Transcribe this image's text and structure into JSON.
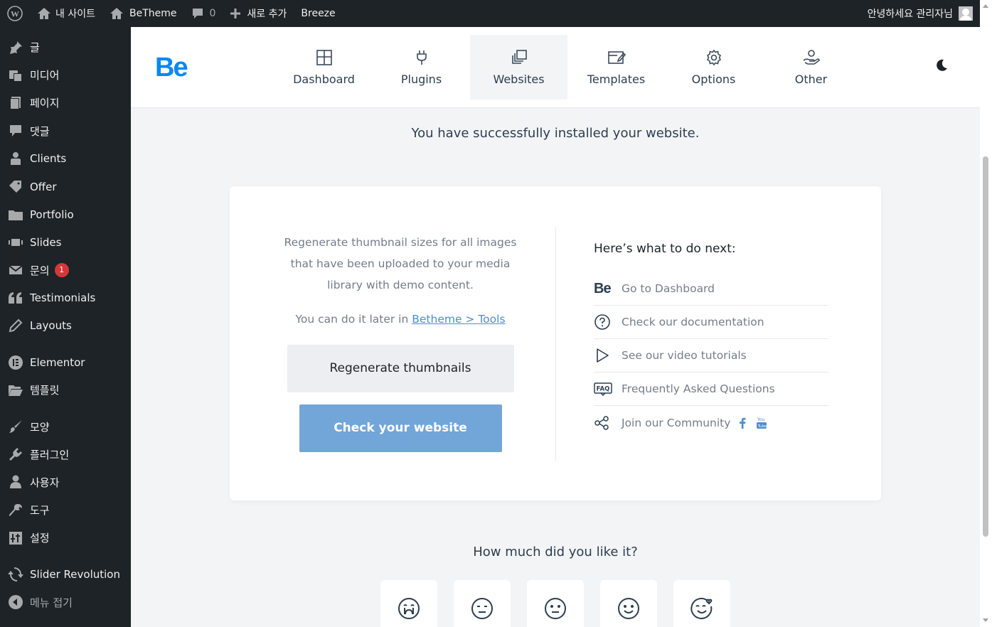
{
  "adminbar": {
    "site_name": "내 사이트",
    "theme": "BeTheme",
    "comments_count": "0",
    "new_label": "새로 추가",
    "breeze": "Breeze",
    "greeting": "안녕하세요 관리자님"
  },
  "sidebar": {
    "items": [
      {
        "label": "글",
        "icon": "pushpin-icon"
      },
      {
        "label": "미디어",
        "icon": "media-icon"
      },
      {
        "label": "페이지",
        "icon": "page-icon"
      },
      {
        "label": "댓글",
        "icon": "comment-icon"
      },
      {
        "label": "Clients",
        "icon": "clients-icon"
      },
      {
        "label": "Offer",
        "icon": "tag-icon"
      },
      {
        "label": "Portfolio",
        "icon": "folder-icon"
      },
      {
        "label": "Slides",
        "icon": "slides-icon"
      },
      {
        "label": "문의",
        "icon": "mail-icon",
        "badge": "1"
      },
      {
        "label": "Testimonials",
        "icon": "quote-icon"
      },
      {
        "label": "Layouts",
        "icon": "pencil-icon"
      },
      {
        "label": "Elementor",
        "icon": "elementor-icon"
      },
      {
        "label": "템플릿",
        "icon": "folder-open-icon"
      },
      {
        "label": "모양",
        "icon": "brush-icon"
      },
      {
        "label": "플러그인",
        "icon": "plugin-icon"
      },
      {
        "label": "사용자",
        "icon": "user-icon"
      },
      {
        "label": "도구",
        "icon": "wrench-icon"
      },
      {
        "label": "설정",
        "icon": "settings-icon"
      },
      {
        "label": "Slider Revolution",
        "icon": "refresh-icon"
      },
      {
        "label": "메뉴 접기",
        "icon": "collapse-icon"
      }
    ]
  },
  "header": {
    "logo": "Be",
    "tabs": [
      {
        "label": "Dashboard",
        "icon": "dashboard-icon"
      },
      {
        "label": "Plugins",
        "icon": "plug-icon"
      },
      {
        "label": "Websites",
        "icon": "websites-icon",
        "active": true
      },
      {
        "label": "Templates",
        "icon": "templates-icon"
      },
      {
        "label": "Options",
        "icon": "gear-icon"
      },
      {
        "label": "Other",
        "icon": "hand-icon"
      }
    ]
  },
  "main": {
    "success_message": "You have successfully installed your website.",
    "regenerate_desc": "Regenerate thumbnail sizes for all images that have been uploaded to your media library with demo content.",
    "later_text": "You can do it later in",
    "later_link": "Betheme > Tools",
    "regenerate_button": "Regenerate thumbnails",
    "check_button": "Check your website",
    "next_title": "Here’s what to do next:",
    "next_items": [
      {
        "label": "Go to Dashboard",
        "icon": "be-icon"
      },
      {
        "label": "Check our documentation",
        "icon": "question-icon"
      },
      {
        "label": "See our video tutorials",
        "icon": "play-icon"
      },
      {
        "label": "Frequently Asked Questions",
        "icon": "faq-icon"
      },
      {
        "label": "Join our Community",
        "icon": "share-icon"
      }
    ],
    "faq_badge": "FAQ",
    "rate_title": "How much did you like it?"
  }
}
